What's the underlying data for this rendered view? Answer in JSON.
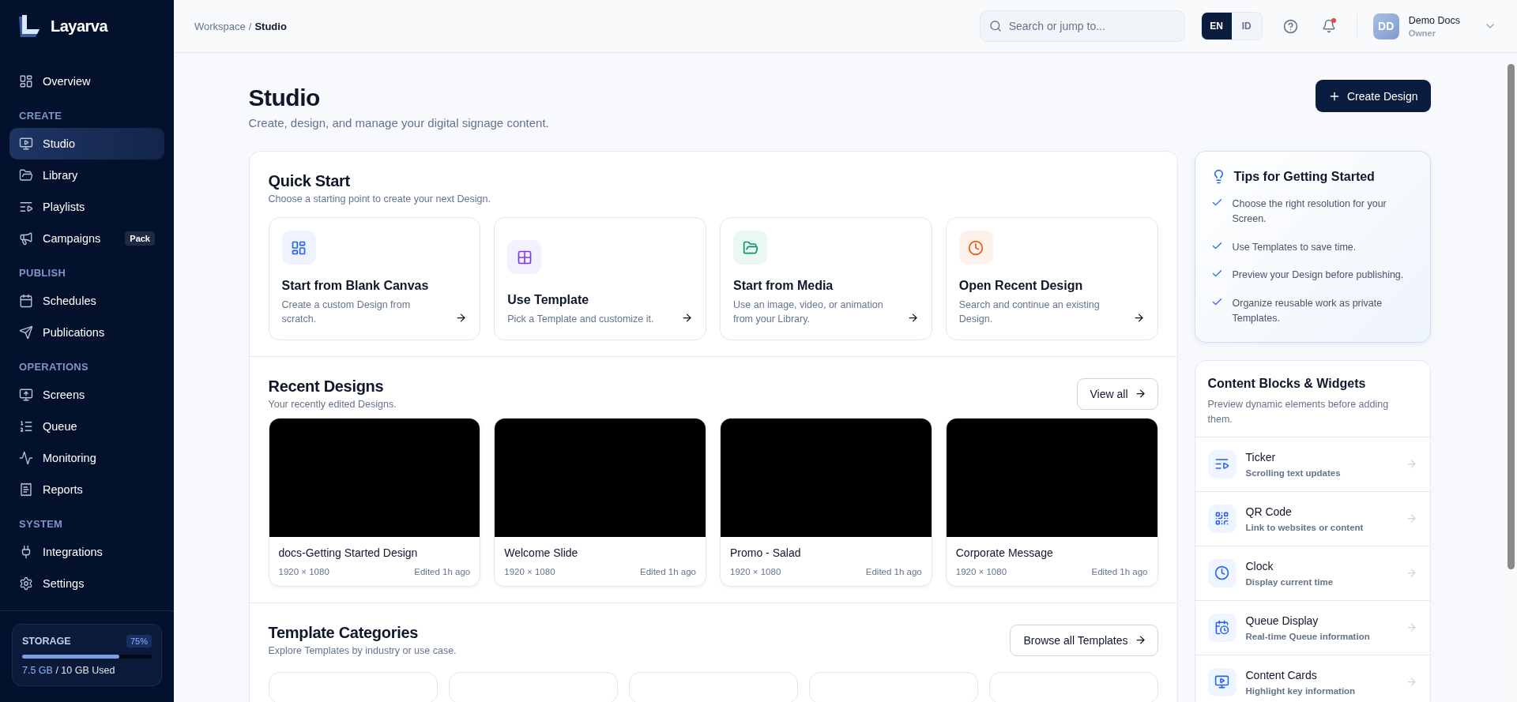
{
  "app": {
    "name": "Layarva"
  },
  "sidebar": {
    "sections": [
      {
        "items": [
          {
            "label": "Overview",
            "selected": false
          }
        ]
      },
      {
        "heading": "CREATE",
        "items": [
          {
            "label": "Studio",
            "selected": true
          },
          {
            "label": "Library",
            "selected": false
          },
          {
            "label": "Playlists",
            "selected": false
          },
          {
            "label": "Campaigns",
            "selected": false,
            "badge": "Pack"
          }
        ]
      },
      {
        "heading": "PUBLISH",
        "items": [
          {
            "label": "Schedules",
            "selected": false
          },
          {
            "label": "Publications",
            "selected": false
          }
        ]
      },
      {
        "heading": "OPERATIONS",
        "items": [
          {
            "label": "Screens",
            "selected": false
          },
          {
            "label": "Queue",
            "selected": false
          },
          {
            "label": "Monitoring",
            "selected": false
          },
          {
            "label": "Reports",
            "selected": false
          }
        ]
      },
      {
        "heading": "SYSTEM",
        "items": [
          {
            "label": "Integrations",
            "selected": false
          },
          {
            "label": "Settings",
            "selected": false
          }
        ]
      }
    ],
    "storage": {
      "label": "STORAGE",
      "percent": "75%",
      "level": 0.75,
      "used": "7.5 GB",
      "total": "/ 10 GB Used"
    }
  },
  "topbar": {
    "breadcrumb": [
      {
        "label": "Workspace"
      },
      {
        "label": "/"
      },
      {
        "label": "Studio"
      }
    ],
    "search": {
      "placeholder": "Search or jump to..."
    },
    "languages": [
      {
        "label": "EN",
        "selected": true
      },
      {
        "label": "ID",
        "selected": false
      }
    ],
    "notifications": {
      "unread": true
    },
    "user": {
      "initials": "DD",
      "name": "Demo Docs",
      "role": "Owner"
    }
  },
  "page": {
    "title": "Studio",
    "subtitle": "Create, design, and manage your digital signage content.",
    "primary_button": "Create Design"
  },
  "quick_start": {
    "title": "Quick Start",
    "subtitle": "Choose a starting point to create your next Design.",
    "cards": [
      {
        "title": "Start from Blank Canvas",
        "description": "Create a custom Design from scratch.",
        "color": "#2563eb"
      },
      {
        "title": "Use Template",
        "description": "Pick a Template and customize it.",
        "color": "#7c3aed"
      },
      {
        "title": "Start from Media",
        "description": "Use an image, video, or animation from your Library.",
        "color": "#059669"
      },
      {
        "title": "Open Recent Design",
        "description": "Search and continue an existing Design.",
        "color": "#ea580c"
      }
    ]
  },
  "recent_designs": {
    "title": "Recent Designs",
    "subtitle": "Your recently edited Designs.",
    "button": "View all",
    "items": [
      {
        "name": "docs-Getting Started Design",
        "size": "1920 × 1080",
        "edited": "Edited 1h ago"
      },
      {
        "name": "Welcome Slide",
        "size": "1920 × 1080",
        "edited": "Edited 1h ago"
      },
      {
        "name": "Promo - Salad",
        "size": "1920 × 1080",
        "edited": "Edited 1h ago"
      },
      {
        "name": "Corporate Message",
        "size": "1920 × 1080",
        "edited": "Edited 1h ago"
      }
    ]
  },
  "template_categories": {
    "title": "Template Categories",
    "subtitle": "Explore Templates by industry or use case.",
    "button": "Browse all Templates"
  },
  "tips": {
    "title": "Tips for Getting Started",
    "items": [
      "Choose the right resolution for your Screen.",
      "Use Templates to save time.",
      "Preview your Design before publishing.",
      "Organize reusable work as private Templates."
    ]
  },
  "widgets": {
    "title": "Content Blocks & Widgets",
    "subtitle": "Preview dynamic elements before adding them.",
    "items": [
      {
        "name": "Ticker",
        "description": "Scrolling text updates"
      },
      {
        "name": "QR Code",
        "description": "Link to websites or content"
      },
      {
        "name": "Clock",
        "description": "Display current time"
      },
      {
        "name": "Queue Display",
        "description": "Real-time Queue information"
      },
      {
        "name": "Content Cards",
        "description": "Highlight key information"
      }
    ]
  }
}
